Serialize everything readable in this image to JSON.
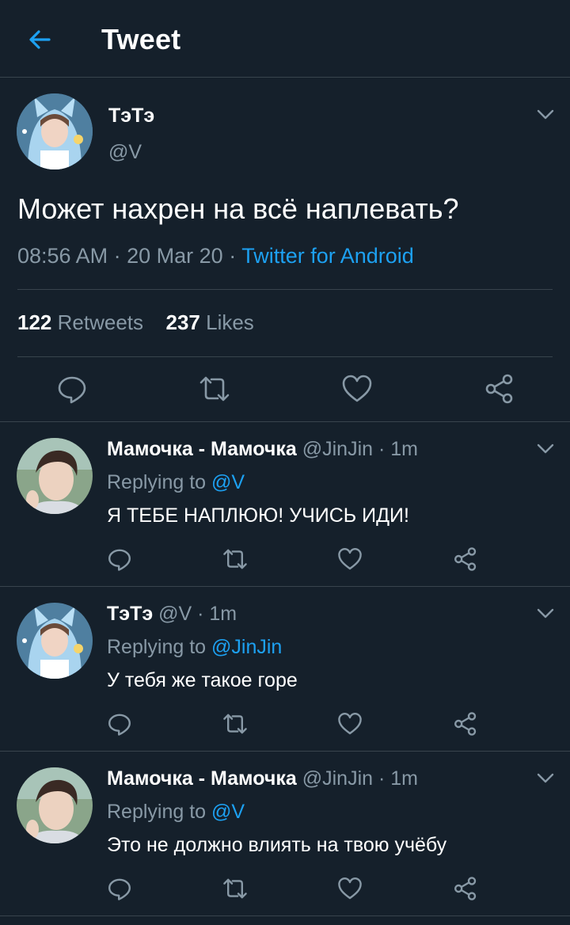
{
  "header": {
    "title": "Tweet"
  },
  "main_tweet": {
    "display_name": "ТэТэ",
    "handle": "@V",
    "text": "Может нахрен на всё наплевать?",
    "time": "08:56 AM",
    "date": "20 Mar 20",
    "source": "Twitter for Android",
    "retweets_count": "122",
    "retweets_label": "Retweets",
    "likes_count": "237",
    "likes_label": "Likes"
  },
  "replies": [
    {
      "display_name": "Мамочка - Мамочка",
      "handle": "@JinJin",
      "time": "1m",
      "replying_label": "Replying to",
      "replying_to": "@V",
      "text": "Я ТЕБЕ НАПЛЮЮ! УЧИСЬ ИДИ!"
    },
    {
      "display_name": "ТэТэ",
      "handle": "@V",
      "time": "1m",
      "replying_label": "Replying to",
      "replying_to": "@JinJin",
      "text": "У тебя же такое горе"
    },
    {
      "display_name": "Мамочка - Мамочка",
      "handle": "@JinJin",
      "time": "1m",
      "replying_label": "Replying to",
      "replying_to": "@V",
      "text": "Это не должно влиять на твою учёбу"
    }
  ],
  "separator": "·",
  "colors": {
    "background": "#15202b",
    "accent": "#1da1f2",
    "secondary_text": "#8899a6",
    "divider": "#38444d"
  },
  "icons": [
    "back-arrow-icon",
    "chevron-down-icon",
    "reply-icon",
    "retweet-icon",
    "like-icon",
    "share-icon"
  ]
}
